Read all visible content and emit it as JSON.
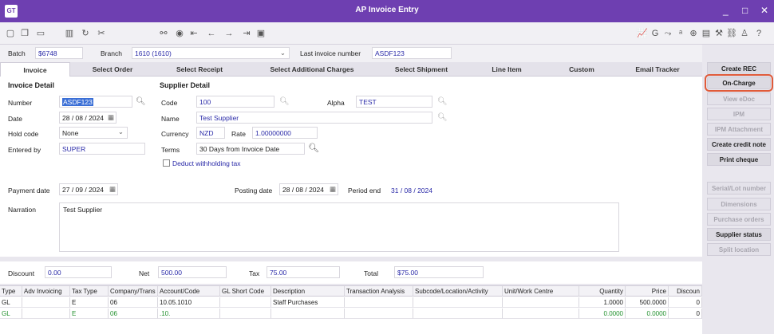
{
  "window": {
    "logo": "GT",
    "title": "AP Invoice Entry",
    "min": "_",
    "max": "□",
    "close": "✕"
  },
  "toolbar": {
    "left_icons": [
      "new-icon",
      "copy-icon",
      "save-icon",
      "delete-icon",
      "refresh-icon",
      "cut-icon"
    ],
    "mid_icons": [
      "binoculars-icon",
      "record-icon",
      "first-icon",
      "prev-icon",
      "next-icon",
      "last-icon",
      "lookup-icon"
    ],
    "right_icons": [
      "chart-icon",
      "gl-icon",
      "link-icon",
      "afs-icon",
      "attach-icon",
      "doc-icon",
      "tools-icon",
      "chain-icon",
      "person-icon",
      "help-icon"
    ]
  },
  "bar2": {
    "batch_label": "Batch",
    "batch_value": "$6748",
    "branch_label": "Branch",
    "branch_value": "1610 (1610)",
    "last_invoice_label": "Last invoice number",
    "last_invoice_value": "ASDF123"
  },
  "tabs": [
    "Invoice",
    "Select Order",
    "Select Receipt",
    "Select Additional Charges",
    "Select Shipment",
    "Line Item",
    "Custom",
    "Email Tracker"
  ],
  "invoice_detail": {
    "header": "Invoice Detail",
    "number_label": "Number",
    "number_value": "ASDF123",
    "date_label": "Date",
    "date_value": "28 / 08 / 2024",
    "hold_label": "Hold code",
    "hold_value": "None",
    "entered_label": "Entered by",
    "entered_value": "SUPER"
  },
  "supplier_detail": {
    "header": "Supplier Detail",
    "code_label": "Code",
    "code_value": "100",
    "alpha_label": "Alpha",
    "alpha_value": "TEST",
    "name_label": "Name",
    "name_value": "Test Supplier",
    "currency_label": "Currency",
    "currency_value": "NZD",
    "rate_label": "Rate",
    "rate_value": "1.00000000",
    "terms_label": "Terms",
    "terms_value": "30 Days from Invoice Date",
    "withholding_label": "Deduct withholding tax"
  },
  "dates": {
    "payment_label": "Payment date",
    "payment_value": "27 / 09 / 2024",
    "posting_label": "Posting date",
    "posting_value": "28 / 08 / 2024",
    "period_label": "Period end",
    "period_value": "31 / 08 / 2024"
  },
  "narration": {
    "label": "Narration",
    "value": "Test Supplier"
  },
  "totals": {
    "discount_label": "Discount",
    "discount_value": "0.00",
    "net_label": "Net",
    "net_value": "500.00",
    "tax_label": "Tax",
    "tax_value": "75.00",
    "total_label": "Total",
    "total_value": "$75.00"
  },
  "sidebar": [
    {
      "label": "Create REC",
      "state": "enabled"
    },
    {
      "label": "On-Charge",
      "state": "highlight"
    },
    {
      "label": "View eDoc",
      "state": "disabled"
    },
    {
      "label": "IPM",
      "state": "disabled"
    },
    {
      "label": "IPM Attachment",
      "state": "disabled"
    },
    {
      "label": "Create credit note",
      "state": "enabled"
    },
    {
      "label": "Print cheque",
      "state": "enabled"
    },
    {
      "label": "Serial/Lot number",
      "state": "disabled"
    },
    {
      "label": "Dimensions",
      "state": "disabled"
    },
    {
      "label": "Purchase orders",
      "state": "disabled"
    },
    {
      "label": "Supplier status",
      "state": "enabled"
    },
    {
      "label": "Split location",
      "state": "disabled"
    }
  ],
  "grid": {
    "columns": [
      "Type",
      "Adv Invoicing",
      "Tax Type",
      "Company/Trans",
      "Account/Code",
      "GL Short Code",
      "Description",
      "Transaction Analysis",
      "Subcode/Location/Activity",
      "Unit/Work Centre",
      "Quantity",
      "Price",
      "Discoun"
    ],
    "rows": [
      [
        "GL",
        "",
        "E",
        "06",
        "10.05.1010",
        "",
        "Staff Purchases",
        "",
        "",
        "",
        "1.0000",
        "500.0000",
        "0"
      ],
      [
        "GL",
        "",
        "E",
        "06",
        ".10.",
        "",
        "",
        "",
        "",
        "",
        "0.0000",
        "0.0000",
        "0"
      ]
    ]
  },
  "colors": {
    "titlebar": "#6e3fb1",
    "value_text": "#2a2aa8",
    "highlight_outline": "#e05b3a",
    "second_row_text": "#1f8f2b"
  }
}
